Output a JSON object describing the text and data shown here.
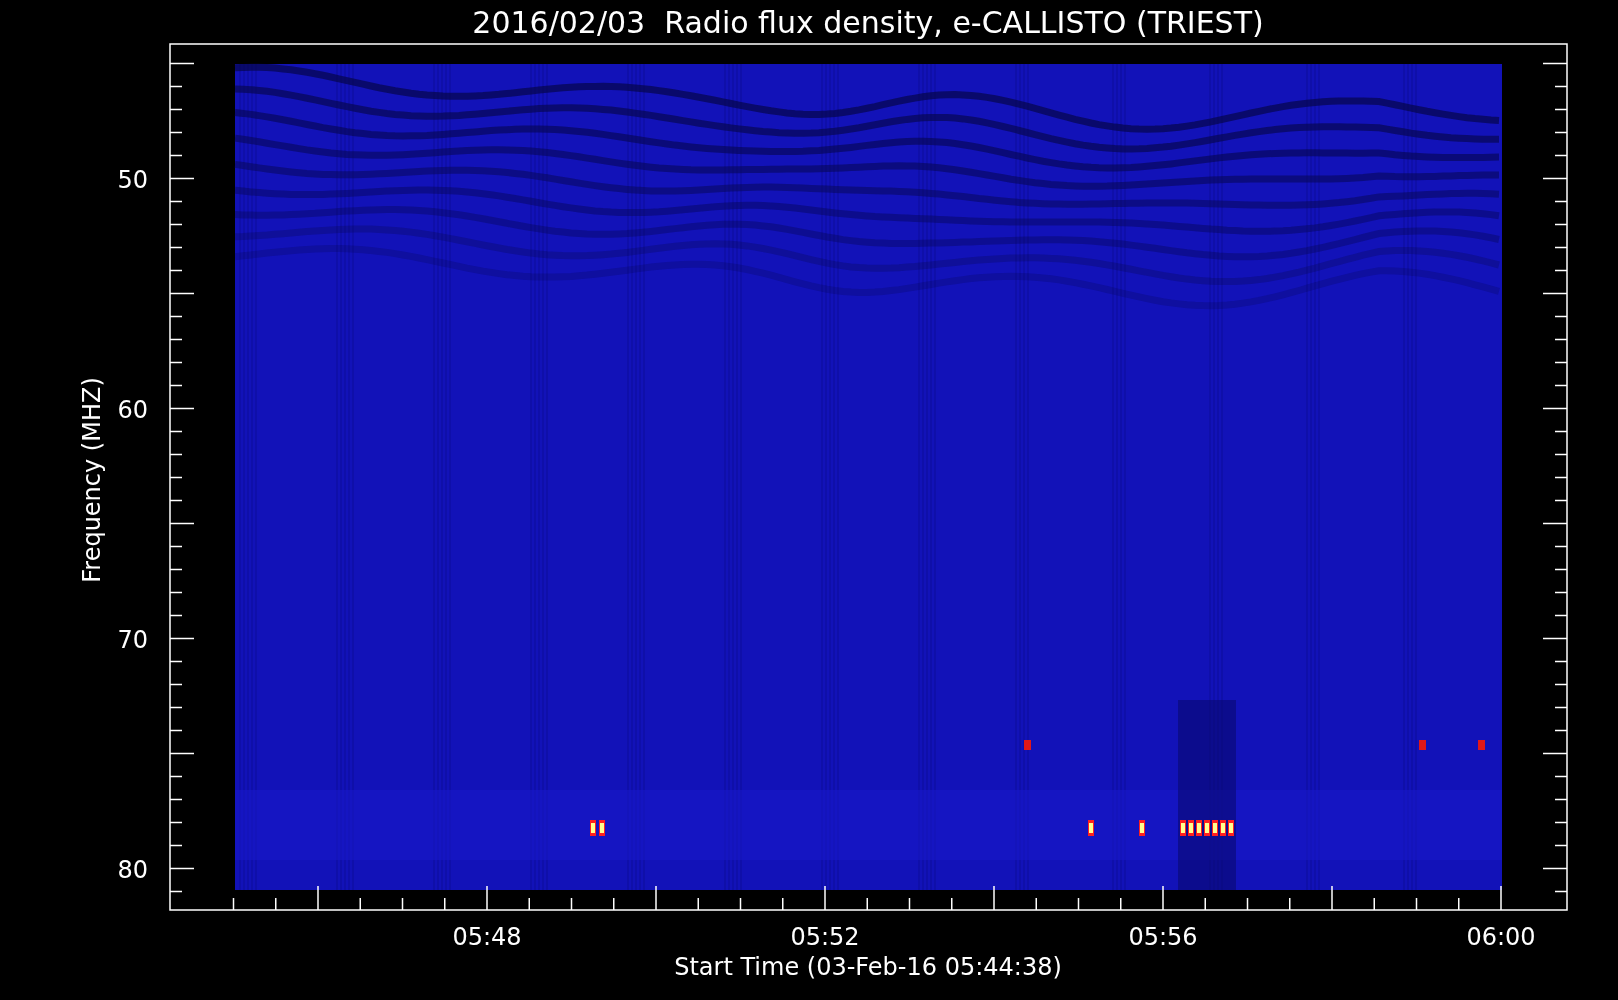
{
  "title": "2016/02/03  Radio flux density, e-CALLISTO (TRIEST)",
  "plot": {
    "ylabel": "Frequency (MHZ)",
    "xlabel": "Start Time (03-Feb-16 05:44:38)",
    "yticks": [
      "50",
      "60",
      "70",
      "80"
    ],
    "xticks": [
      "05:48",
      "05:52",
      "05:56",
      "06:00"
    ]
  }
}
